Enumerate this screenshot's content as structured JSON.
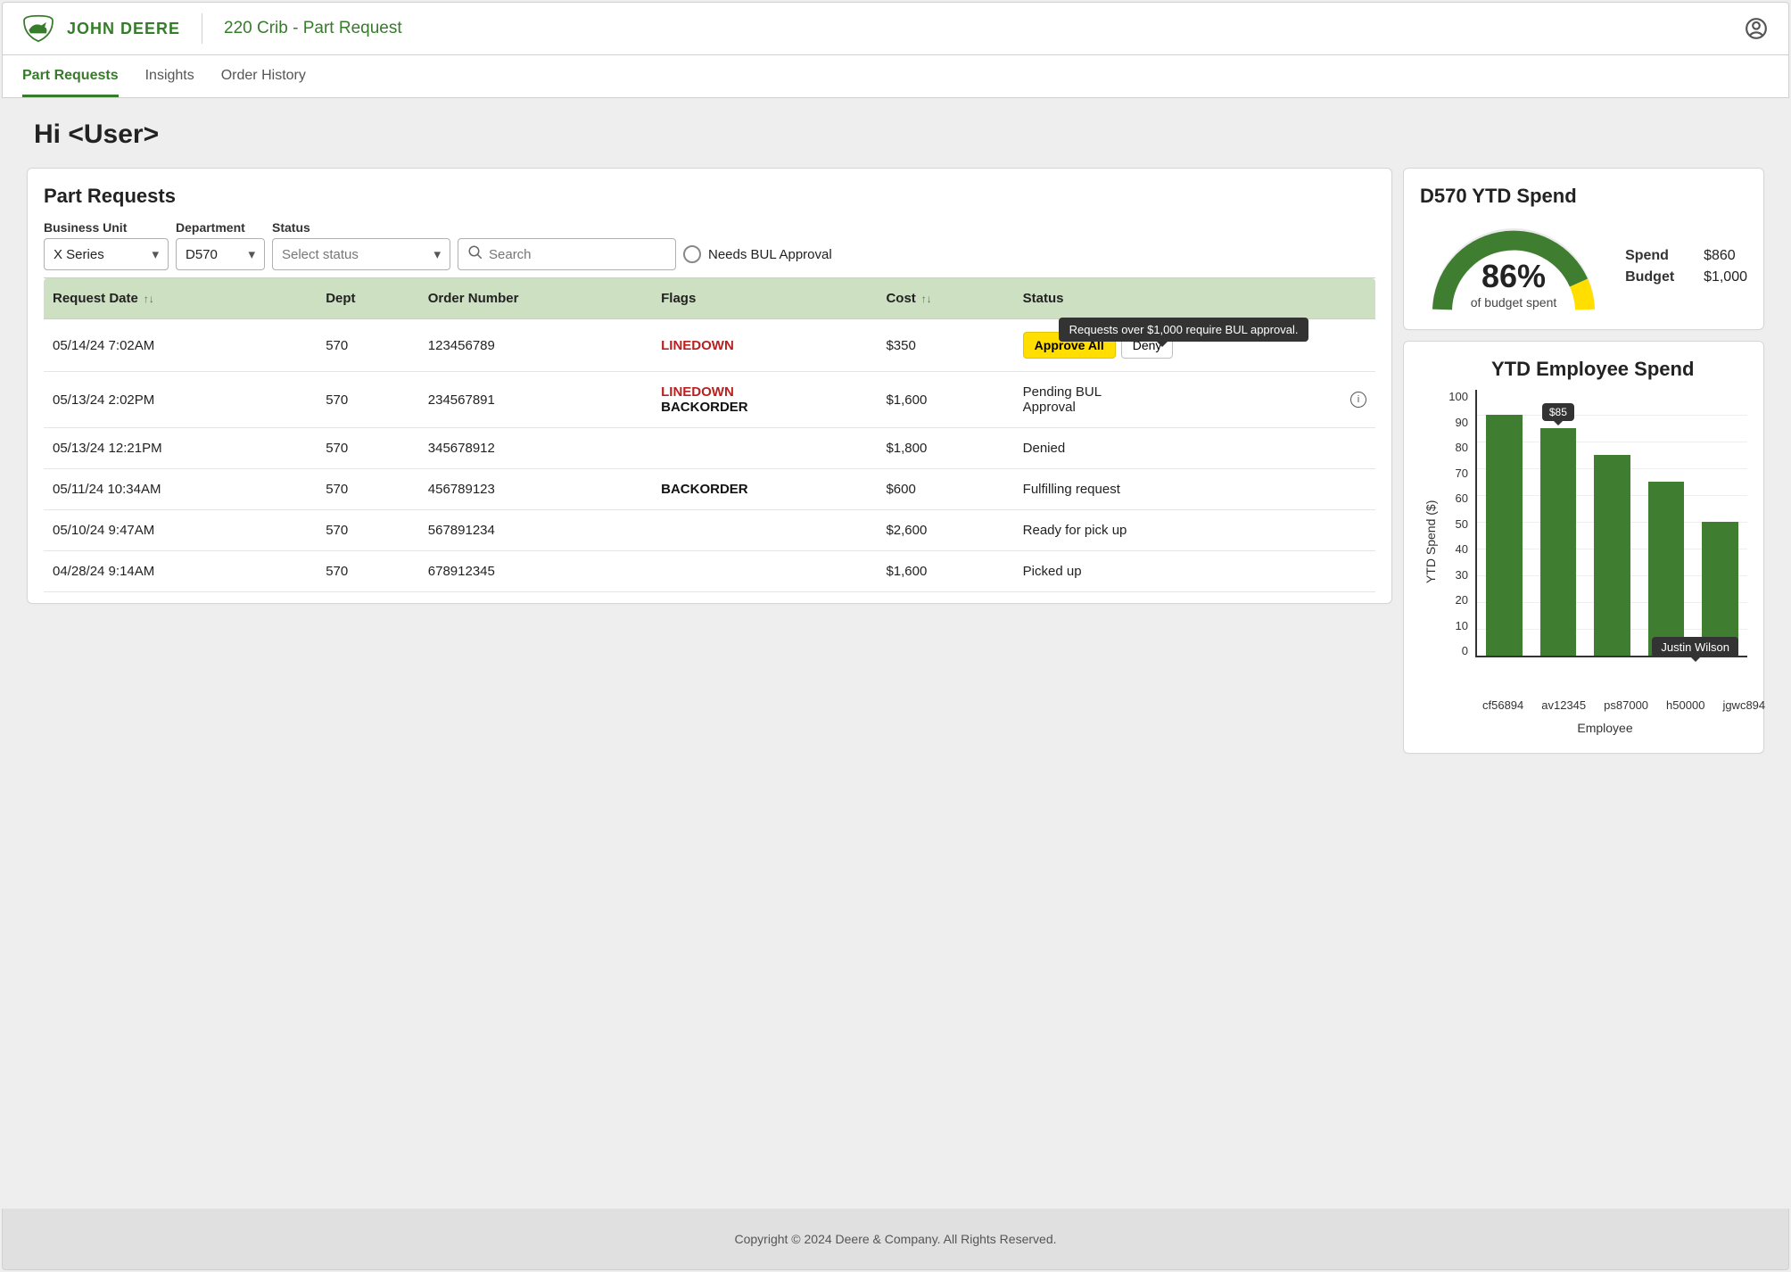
{
  "brand": {
    "name": "John Deere",
    "page_title": "220 Crib - Part Request"
  },
  "tabs": {
    "part_requests": "Part Requests",
    "insights": "Insights",
    "order_history": "Order History"
  },
  "greeting": "Hi <User>",
  "requests_card": {
    "title": "Part Requests",
    "filters": {
      "business_unit": {
        "label": "Business Unit",
        "value": "X Series"
      },
      "department": {
        "label": "Department",
        "value": "D570"
      },
      "status": {
        "label": "Status",
        "placeholder": "Select status"
      },
      "search_placeholder": "Search",
      "bul_toggle": "Needs BUL Approval"
    },
    "columns": {
      "request_date": "Request Date",
      "dept": "Dept",
      "order_number": "Order Number",
      "flags": "Flags",
      "cost": "Cost",
      "status": "Status"
    },
    "tooltip": "Requests over $1,000 require BUL approval.",
    "actions": {
      "approve_all": "Approve All",
      "deny": "Deny"
    },
    "rows": [
      {
        "date": "05/14/24 7:02AM",
        "dept": "570",
        "order": "123456789",
        "flag1": "LINEDOWN",
        "flag2": "",
        "cost": "$350",
        "status": ""
      },
      {
        "date": "05/13/24 2:02PM",
        "dept": "570",
        "order": "234567891",
        "flag1": "LINEDOWN",
        "flag2": "BACKORDER",
        "cost": "$1,600",
        "status": "Pending BUL Approval"
      },
      {
        "date": "05/13/24 12:21PM",
        "dept": "570",
        "order": "345678912",
        "flag1": "",
        "flag2": "",
        "cost": "$1,800",
        "status": "Denied"
      },
      {
        "date": "05/11/24 10:34AM",
        "dept": "570",
        "order": "456789123",
        "flag1": "",
        "flag2": "BACKORDER",
        "cost": "$600",
        "status": "Fulfilling request"
      },
      {
        "date": "05/10/24 9:47AM",
        "dept": "570",
        "order": "567891234",
        "flag1": "",
        "flag2": "",
        "cost": "$2,600",
        "status": "Ready for pick up"
      },
      {
        "date": "04/28/24 9:14AM",
        "dept": "570",
        "order": "678912345",
        "flag1": "",
        "flag2": "",
        "cost": "$1,600",
        "status": "Picked up"
      }
    ]
  },
  "spend_card": {
    "title": "D570 YTD Spend",
    "pct": "86%",
    "sub": "of budget spent",
    "spend_label": "Spend",
    "spend_value": "$860",
    "budget_label": "Budget",
    "budget_value": "$1,000"
  },
  "employee_chart": {
    "title": "YTD Employee Spend",
    "ylabel": "YTD Spend ($)",
    "xlabel": "Employee",
    "bar_tooltip": "$85",
    "cat_tooltip": "Justin Wilson"
  },
  "chart_data": {
    "type": "bar",
    "title": "YTD Employee Spend",
    "ylabel": "YTD Spend ($)",
    "xlabel": "Employee",
    "ylim": [
      0,
      100
    ],
    "yticks": [
      0,
      10,
      20,
      30,
      40,
      50,
      60,
      70,
      80,
      90,
      100
    ],
    "categories": [
      "cf56894",
      "av12345",
      "ps87000",
      "h50000",
      "jgwc894"
    ],
    "values": [
      90,
      85,
      75,
      65,
      50
    ],
    "highlighted_index": 1,
    "highlighted_value_label": "$85",
    "highlighted_category_label": "Justin Wilson",
    "highlighted_category_index": 4
  },
  "footer": "Copyright © 2024 Deere & Company. All Rights Reserved."
}
